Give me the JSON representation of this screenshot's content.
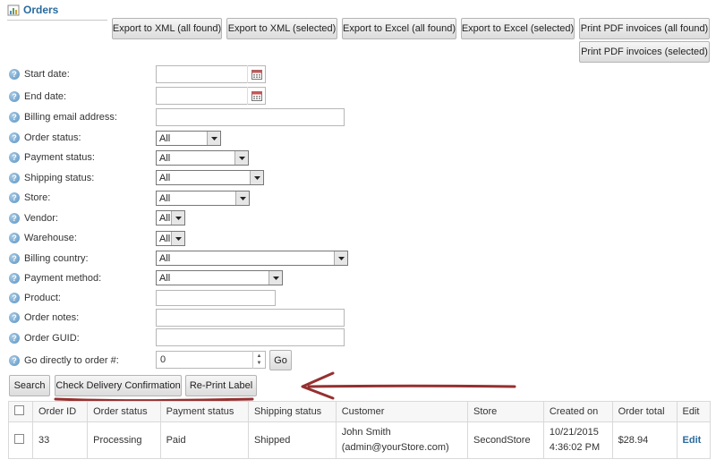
{
  "page": {
    "title": "Orders"
  },
  "toolbar": {
    "export_xml_all": "Export to XML (all found)",
    "export_xml_selected": "Export to XML (selected)",
    "export_excel_all": "Export to Excel (all found)",
    "export_excel_selected": "Export to Excel (selected)",
    "print_pdf_all": "Print PDF invoices (all found)",
    "print_pdf_selected": "Print PDF invoices (selected)"
  },
  "filters": {
    "start_date": {
      "label": "Start date:",
      "value": ""
    },
    "end_date": {
      "label": "End date:",
      "value": ""
    },
    "billing_email": {
      "label": "Billing email address:",
      "value": ""
    },
    "order_status": {
      "label": "Order status:",
      "value": "All"
    },
    "payment_status": {
      "label": "Payment status:",
      "value": "All"
    },
    "shipping_status": {
      "label": "Shipping status:",
      "value": "All"
    },
    "store": {
      "label": "Store:",
      "value": "All"
    },
    "vendor": {
      "label": "Vendor:",
      "value": "All"
    },
    "warehouse": {
      "label": "Warehouse:",
      "value": "All"
    },
    "billing_country": {
      "label": "Billing country:",
      "value": "All"
    },
    "payment_method": {
      "label": "Payment method:",
      "value": "All"
    },
    "product": {
      "label": "Product:",
      "value": ""
    },
    "order_notes": {
      "label": "Order notes:",
      "value": ""
    },
    "order_guid": {
      "label": "Order GUID:",
      "value": ""
    },
    "go_to_order": {
      "label": "Go directly to order #:",
      "value": "0",
      "go_label": "Go"
    }
  },
  "actions": {
    "search": "Search",
    "check_delivery": "Check Delivery Confirmation",
    "reprint_label": "Re-Print Label"
  },
  "table": {
    "headers": [
      "Order ID",
      "Order status",
      "Payment status",
      "Shipping status",
      "Customer",
      "Store",
      "Created on",
      "Order total",
      "Edit"
    ],
    "rows": [
      {
        "order_id": "33",
        "order_status": "Processing",
        "payment_status": "Paid",
        "shipping_status": "Shipped",
        "customer_name": "John Smith",
        "customer_email": "(admin@yourStore.com)",
        "store": "SecondStore",
        "created_date": "10/21/2015",
        "created_time": "4:36:02 PM",
        "order_total": "$28.94",
        "edit": "Edit"
      }
    ]
  },
  "colors": {
    "accent": "#2a6a9e",
    "annotation": "#8b1a1a"
  }
}
